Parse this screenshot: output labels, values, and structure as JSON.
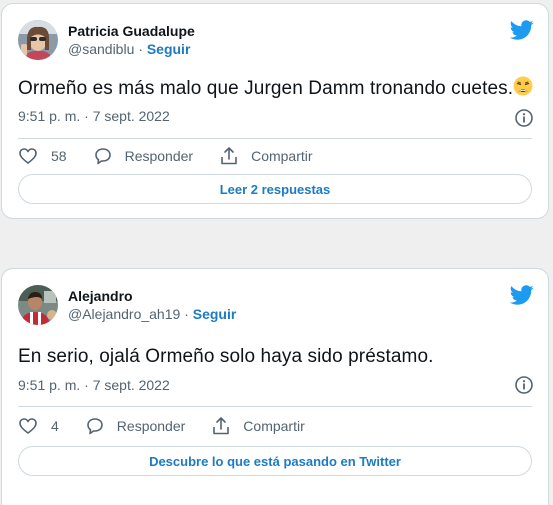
{
  "tweets": [
    {
      "author": "Patricia Guadalupe",
      "handle": "@sandiblu",
      "separator": "·",
      "follow": "Seguir",
      "text": "Ormeño es más malo que Jurgen Damm tronando cuetes.",
      "emoji_icon": "weary-face-icon",
      "timestamp": "9:51 p. m. · 7 sept. 2022",
      "likes": "58",
      "reply_label": "Responder",
      "share_label": "Compartir",
      "cta": "Leer 2 respuestas"
    },
    {
      "author": "Alejandro",
      "handle": "@Alejandro_ah19",
      "separator": "·",
      "follow": "Seguir",
      "text": "En serio, ojalá Ormeño solo haya sido préstamo.",
      "timestamp": "9:51 p. m. · 7 sept. 2022",
      "likes": "4",
      "reply_label": "Responder",
      "share_label": "Compartir",
      "cta": "Descubre lo que está pasando en Twitter"
    }
  ],
  "colors": {
    "brand": "#1d9bf0",
    "link": "#1d7bc2",
    "muted": "#536471",
    "border": "#cfd9de"
  }
}
